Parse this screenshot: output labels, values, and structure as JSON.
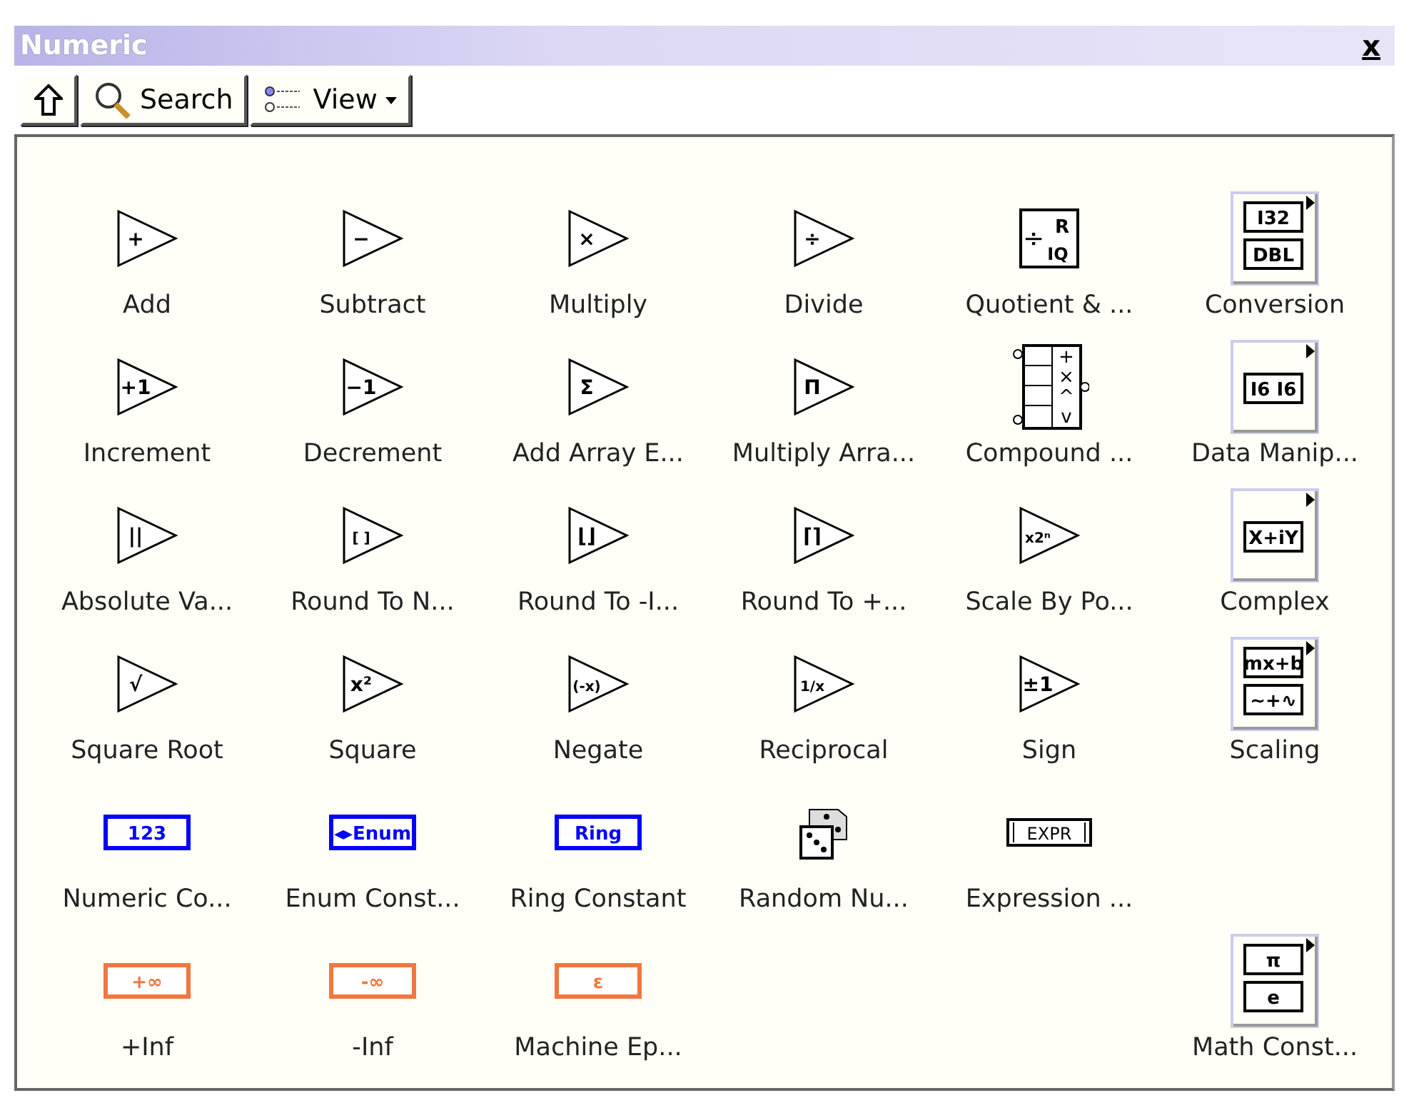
{
  "window": {
    "title": "Numeric",
    "close": "x"
  },
  "toolbar": {
    "search": "Search",
    "view": "View"
  },
  "rows": [
    [
      {
        "kind": "function",
        "glyph": "+",
        "label": "Add"
      },
      {
        "kind": "function",
        "glyph": "−",
        "label": "Subtract"
      },
      {
        "kind": "function",
        "glyph": "×",
        "label": "Multiply"
      },
      {
        "kind": "function",
        "glyph": "÷",
        "label": "Divide"
      },
      {
        "kind": "quotient",
        "glyphs": [
          "÷",
          "R",
          "IQ"
        ],
        "label": "Quotient & ..."
      },
      {
        "kind": "subpalette",
        "glyphs": [
          "I32",
          "DBL"
        ],
        "label": "Conversion"
      }
    ],
    [
      {
        "kind": "function",
        "glyph": "+1",
        "label": "Increment"
      },
      {
        "kind": "function",
        "glyph": "−1",
        "label": "Decrement"
      },
      {
        "kind": "function",
        "glyph": "Σ",
        "label": "Add Array E..."
      },
      {
        "kind": "function",
        "glyph": "Π",
        "label": "Multiply Arra..."
      },
      {
        "kind": "compound",
        "glyphs": [
          "+",
          "×",
          "^",
          "v"
        ],
        "label": "Compound ..."
      },
      {
        "kind": "subpalette",
        "glyphs": [
          "I6 I6"
        ],
        "label": "Data Manip..."
      }
    ],
    [
      {
        "kind": "function",
        "glyph": "||",
        "label": "Absolute Va..."
      },
      {
        "kind": "function",
        "glyph": "[ ]",
        "label": "Round To N..."
      },
      {
        "kind": "function",
        "glyph": "⌊⌋",
        "label": "Round To -I..."
      },
      {
        "kind": "function",
        "glyph": "⌈⌉",
        "label": "Round To +..."
      },
      {
        "kind": "function",
        "glyph": "x2ⁿ",
        "label": "Scale By Po..."
      },
      {
        "kind": "subpalette",
        "glyphs": [
          "X+iY"
        ],
        "label": "Complex"
      }
    ],
    [
      {
        "kind": "function",
        "glyph": "√",
        "label": "Square Root"
      },
      {
        "kind": "function",
        "glyph": "x²",
        "label": "Square"
      },
      {
        "kind": "function",
        "glyph": "(-x)",
        "label": "Negate"
      },
      {
        "kind": "function",
        "glyph": "1/x",
        "label": "Reciprocal"
      },
      {
        "kind": "function",
        "glyph": "±1",
        "label": "Sign"
      },
      {
        "kind": "subpalette",
        "glyphs": [
          "mx+b",
          "~+∿"
        ],
        "label": "Scaling"
      }
    ],
    [
      {
        "kind": "constant",
        "color": "#0000ff",
        "glyph": "123",
        "label": "Numeric Co..."
      },
      {
        "kind": "constant",
        "color": "#0000ff",
        "glyph": "◂▸Enum",
        "label": "Enum Const..."
      },
      {
        "kind": "constant",
        "color": "#0000ff",
        "glyph": "Ring",
        "label": "Ring Constant"
      },
      {
        "kind": "dice",
        "label": "Random Nu..."
      },
      {
        "kind": "expression",
        "glyph": "EXPR",
        "label": "Expression ..."
      },
      {
        "kind": "blank"
      }
    ],
    [
      {
        "kind": "constant",
        "color": "#f07840",
        "glyph": "+∞",
        "label": "+Inf"
      },
      {
        "kind": "constant",
        "color": "#f07840",
        "glyph": "-∞",
        "label": "-Inf"
      },
      {
        "kind": "constant",
        "color": "#f07840",
        "glyph": "ε",
        "label": "Machine Ep..."
      },
      {
        "kind": "blank"
      },
      {
        "kind": "blank"
      },
      {
        "kind": "subpalette",
        "glyphs": [
          "π",
          "e"
        ],
        "label": "Math Const..."
      }
    ]
  ]
}
